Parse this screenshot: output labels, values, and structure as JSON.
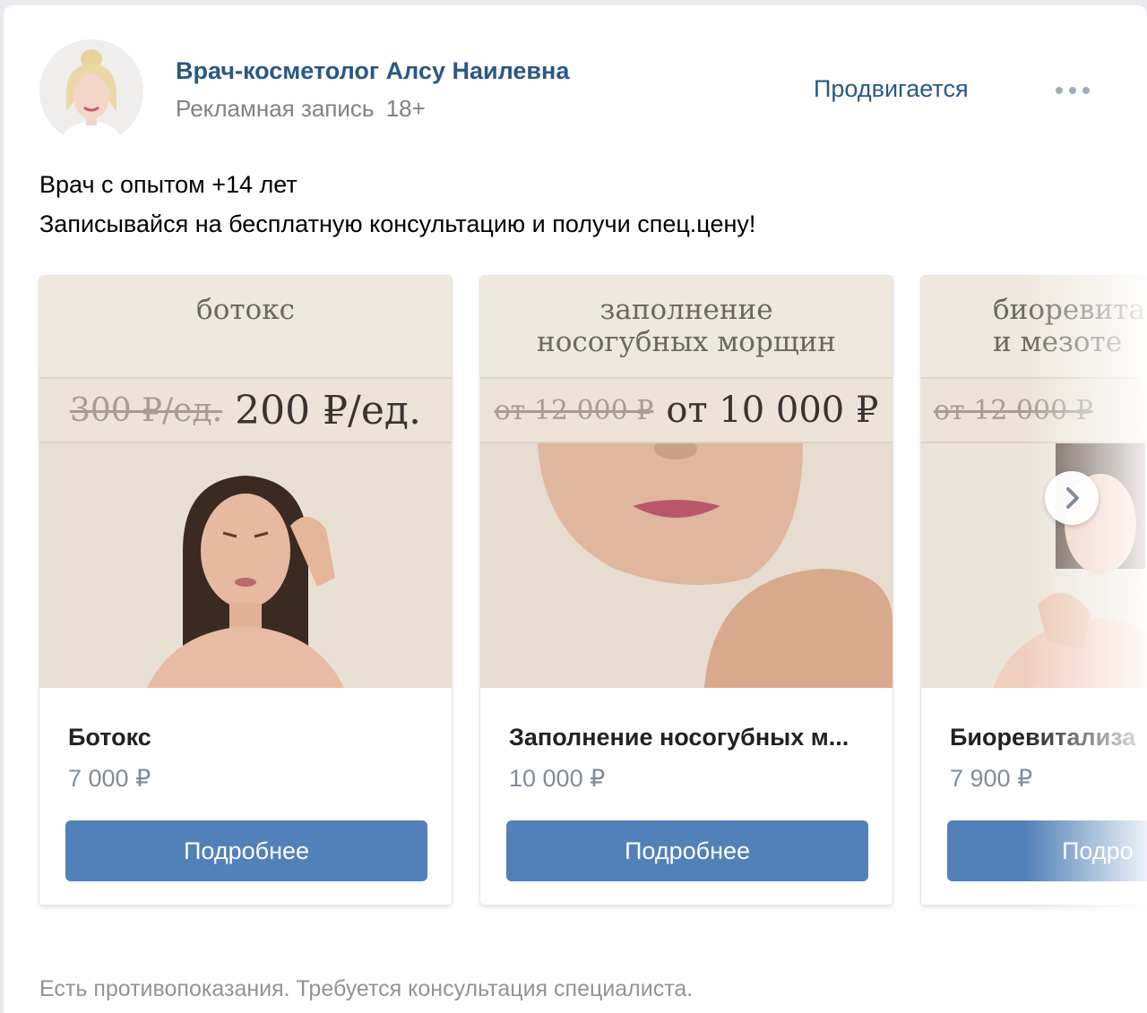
{
  "author": {
    "name": "Врач-косметолог Алсу Наилевна",
    "ad_label": "Рекламная запись",
    "age_label": "18+"
  },
  "promoted_label": "Продвигается",
  "more_icon": "more-horizontal-icon",
  "text_lines": [
    "Врач с опытом +14 лет",
    "Записывайся на бесплатную консультацию и получи спец.цену!"
  ],
  "cards": [
    {
      "banner_head": "ботокс",
      "banner_old_price": "300 ₽/ед.",
      "banner_new_price": "200 ₽/ед.",
      "title": "Ботокс",
      "price": "7 000 ₽",
      "button": "Подробнее"
    },
    {
      "banner_head": "заполнение\nносогубных морщин",
      "banner_old_price": "от 12 000 ₽",
      "banner_new_price": "от 10 000 ₽",
      "title": "Заполнение носогубных м...",
      "price": "10 000 ₽",
      "button": "Подробнее"
    },
    {
      "banner_head": "биоревита\nи мезоте",
      "banner_old_price": "от 12 000 ₽",
      "banner_new_price": "",
      "title": "Биоревитализа",
      "price": "7 900 ₽",
      "button": "Подро"
    }
  ],
  "carousel_next_icon": "chevron-right-icon",
  "disclaimer": "Есть противопоказания. Требуется консультация специалиста.",
  "colors": {
    "link": "#2a5885",
    "button": "#5181b8",
    "banner": "#efe8de",
    "muted": "#828282"
  }
}
